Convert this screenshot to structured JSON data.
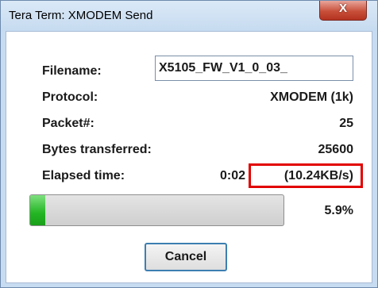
{
  "window": {
    "title": "Tera Term: XMODEM Send",
    "close_glyph": "X"
  },
  "fields": {
    "filename_label": "Filename:",
    "filename_value": "X5105_FW_V1_0_03_",
    "protocol_label": "Protocol:",
    "protocol_value": "XMODEM (1k)",
    "packet_label": "Packet#:",
    "packet_value": "25",
    "bytes_label": "Bytes transferred:",
    "bytes_value": "25600",
    "elapsed_label": "Elapsed time:",
    "elapsed_time": "0:02",
    "rate": "(10.24KB/s)"
  },
  "progress": {
    "percent_text": "5.9%",
    "fraction": 0.059
  },
  "buttons": {
    "cancel": "Cancel"
  },
  "colors": {
    "highlight": "#e20000",
    "progress_fill": "#23b523"
  }
}
